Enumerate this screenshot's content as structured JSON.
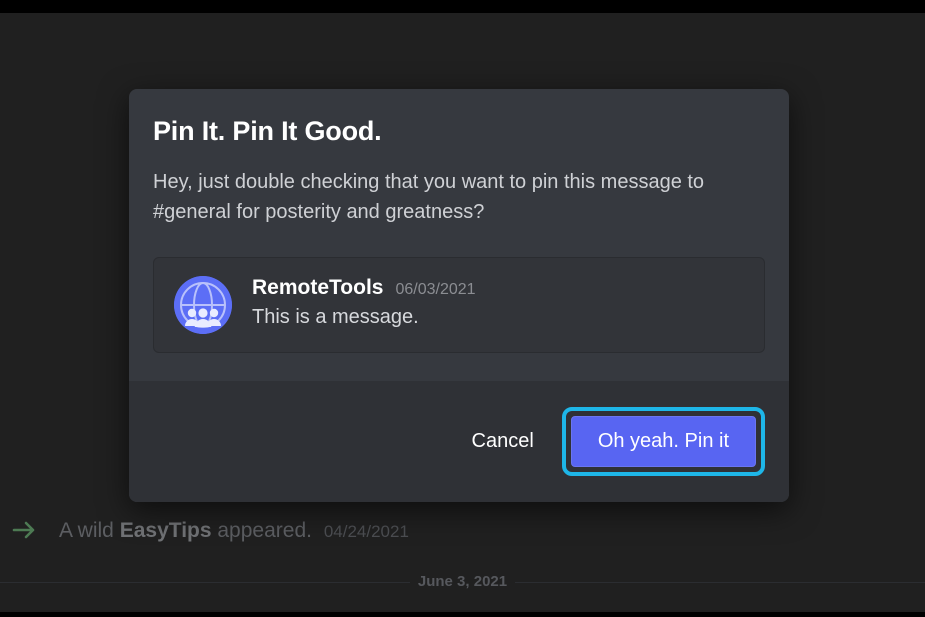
{
  "modal": {
    "title": "Pin It. Pin It Good.",
    "description": "Hey, just double checking that you want to pin this message to #general for posterity and greatness?",
    "message": {
      "author": "RemoteTools",
      "timestamp": "06/03/2021",
      "content": "This is a message."
    },
    "footer": {
      "cancel_label": "Cancel",
      "confirm_label": "Oh yeah. Pin it"
    }
  },
  "background": {
    "system_message": {
      "prefix": "A wild ",
      "username": "EasyTips",
      "suffix": " appeared.",
      "date": "04/24/2021"
    },
    "divider_date": "June 3, 2021"
  }
}
